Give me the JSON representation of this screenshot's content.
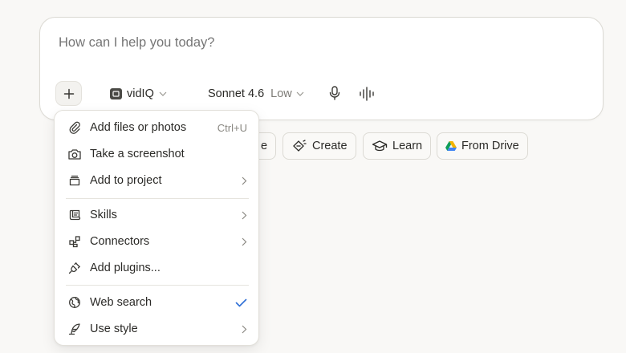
{
  "composer": {
    "placeholder": "How can I help you today?",
    "project_name": "vidIQ",
    "model_name": "Sonnet 4.6",
    "model_level": "Low"
  },
  "chips": [
    {
      "label": "e",
      "icon": "write-icon"
    },
    {
      "label": "Create",
      "icon": "create-icon"
    },
    {
      "label": "Learn",
      "icon": "graduation-cap-icon"
    },
    {
      "label": "From Drive",
      "icon": "google-drive-icon"
    }
  ],
  "menu": {
    "items": [
      {
        "label": "Add files or photos",
        "shortcut": "Ctrl+U",
        "icon": "paperclip-icon"
      },
      {
        "label": "Take a screenshot",
        "icon": "camera-icon"
      },
      {
        "label": "Add to project",
        "icon": "project-box-icon",
        "submenu": true
      },
      {
        "label": "Skills",
        "icon": "scroll-icon",
        "submenu": true
      },
      {
        "label": "Connectors",
        "icon": "connectors-icon",
        "submenu": true
      },
      {
        "label": "Add plugins...",
        "icon": "plug-icon"
      },
      {
        "label": "Web search",
        "icon": "globe-icon",
        "checked": true
      },
      {
        "label": "Use style",
        "icon": "feather-icon",
        "submenu": true
      }
    ]
  },
  "colors": {
    "background": "#f9f8f6",
    "check": "#2f6fd6",
    "drive_yellow": "#f4b400",
    "drive_green": "#0f9d58",
    "drive_blue": "#4285f4"
  }
}
